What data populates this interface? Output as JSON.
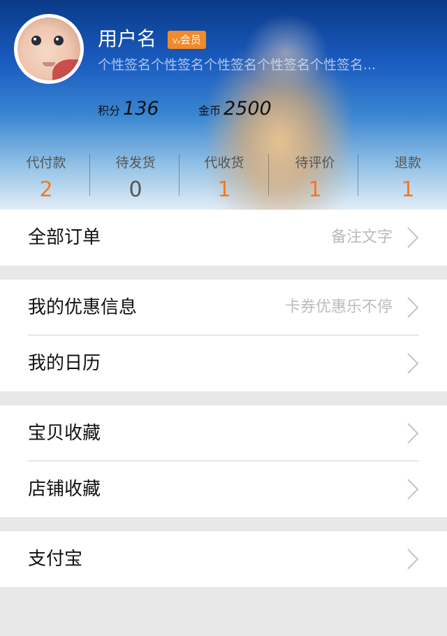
{
  "profile": {
    "username": "用户名",
    "vip_badge": "会员",
    "vip_level": "V₂",
    "signature": "个性签名个性签名个性签名个性签名个性签名...",
    "points_label": "积分",
    "points_value": "136",
    "coins_label": "金币",
    "coins_value": "2500"
  },
  "order_status": [
    {
      "label": "代付款",
      "count": "2",
      "color": "#f07c22"
    },
    {
      "label": "待发货",
      "count": "0",
      "color": "#555555"
    },
    {
      "label": "代收货",
      "count": "1",
      "color": "#f07c22"
    },
    {
      "label": "待评价",
      "count": "1",
      "color": "#f07c22"
    },
    {
      "label": "退款",
      "count": "1",
      "color": "#f07c22"
    }
  ],
  "menu": {
    "all_orders": {
      "title": "全部订单",
      "note": "备注文字"
    },
    "my_offers": {
      "title": "我的优惠信息",
      "note": "卡券优惠乐不停"
    },
    "my_calendar": {
      "title": "我的日历"
    },
    "favorite_items": {
      "title": "宝贝收藏"
    },
    "favorite_shops": {
      "title": "店铺收藏"
    },
    "alipay": {
      "title": "支付宝"
    }
  },
  "icons": {
    "row_arrow": "chevron-right-icon",
    "vip": "vip-badge"
  },
  "colors": {
    "accent": "#f07c22",
    "badge": "#f08a2a",
    "background": "#e8e8e8"
  }
}
